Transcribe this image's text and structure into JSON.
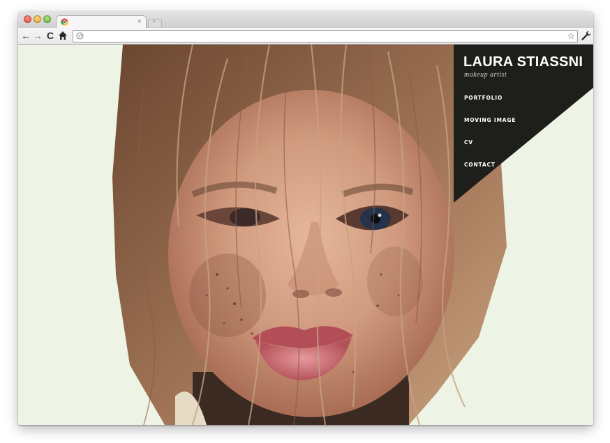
{
  "browser": {
    "tab_title": "",
    "tab_close": "×",
    "new_tab": "+",
    "address": "",
    "nav_icons": {
      "back": "←",
      "forward": "→",
      "reload": "C",
      "home": "⌂"
    },
    "bookmark_star": "☆"
  },
  "site": {
    "title": "LAURA STIASSNI",
    "subtitle": "makeup artist",
    "menu": [
      {
        "label": "PORTFOLIO"
      },
      {
        "label": "MOVING IMAGE"
      },
      {
        "label": "CV"
      },
      {
        "label": "CONTACT"
      }
    ]
  },
  "colors": {
    "panel": "#1e1f1b",
    "page_background": "#edf4e6",
    "menu_text": "#ffffff"
  }
}
